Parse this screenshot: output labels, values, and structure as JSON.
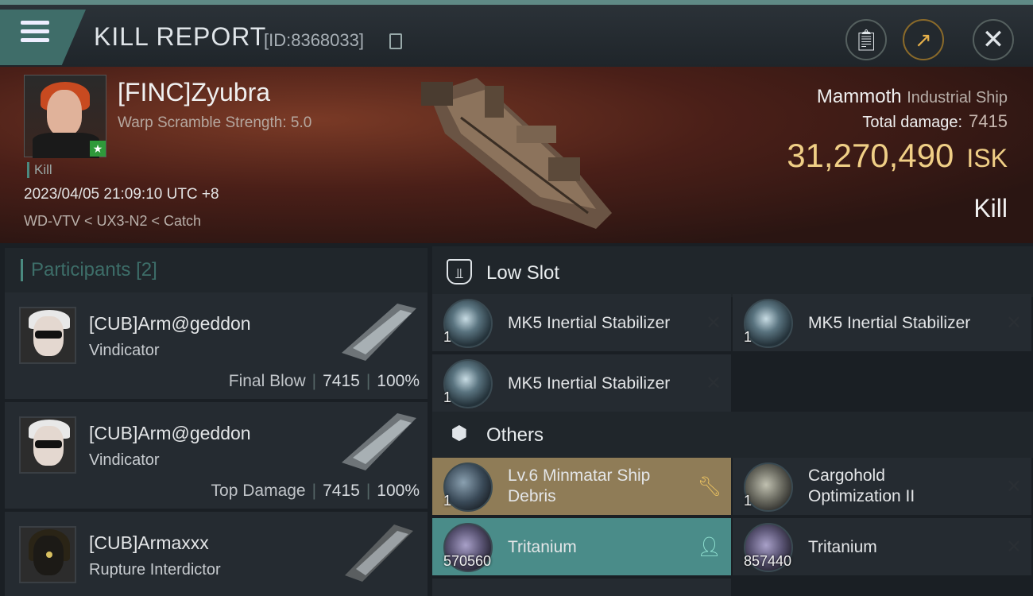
{
  "header": {
    "title": "KILL REPORT",
    "report_id": "[ID:8368033]",
    "buttons": [
      "clipboard-icon",
      "share-icon",
      "close-icon"
    ]
  },
  "victim": {
    "name": "[FINC]Zyubra",
    "scramble": "Warp Scramble Strength: 5.0",
    "kill_tag": "Kill",
    "datetime": "2023/04/05 21:09:10 UTC +8",
    "location": "WD-VTV < UX3-N2 < Catch",
    "ship_name": "Mammoth",
    "ship_class": "Industrial Ship",
    "total_damage_label": "Total damage:",
    "total_damage": "7415",
    "isk_value": "31,270,490",
    "isk_unit": "ISK",
    "result": "Kill"
  },
  "participants": {
    "label": "Participants",
    "count": "[2]",
    "rows": [
      {
        "name": "[CUB]Arm@geddon",
        "ship": "Vindicator",
        "role": "Final Blow",
        "damage": "7415",
        "percent": "100%"
      },
      {
        "name": "[CUB]Arm@geddon",
        "ship": "Vindicator",
        "role": "Top Damage",
        "damage": "7415",
        "percent": "100%"
      },
      {
        "name": "[CUB]Armaxxx",
        "ship": "Rupture Interdictor"
      }
    ]
  },
  "low_slot": {
    "label": "Low Slot",
    "items": [
      {
        "name": "MK5 Inertial Stabilizer",
        "qty": "1",
        "status": "destroyed"
      },
      {
        "name": "MK5 Inertial Stabilizer",
        "qty": "1",
        "status": "destroyed"
      },
      {
        "name": "MK5 Inertial Stabilizer",
        "qty": "1",
        "status": "destroyed"
      }
    ]
  },
  "others": {
    "label": "Others",
    "items": [
      {
        "name_line1": "Lv.6 Minmatar Ship",
        "name_line2": "Debris",
        "qty": "1",
        "status": "dropped-repairable"
      },
      {
        "name_line1": "Cargohold",
        "name_line2": "Optimization II",
        "qty": "1",
        "status": "destroyed"
      },
      {
        "name": "Tritanium",
        "qty": "570560",
        "status": "dropped-user"
      },
      {
        "name": "Tritanium",
        "qty": "857440",
        "status": "destroyed"
      }
    ]
  },
  "colors": {
    "accent": "#4a8a80",
    "isk_gold": "#f0cf86",
    "dropped_gold": "#8f7c57",
    "dropped_teal": "#4a8c89"
  }
}
